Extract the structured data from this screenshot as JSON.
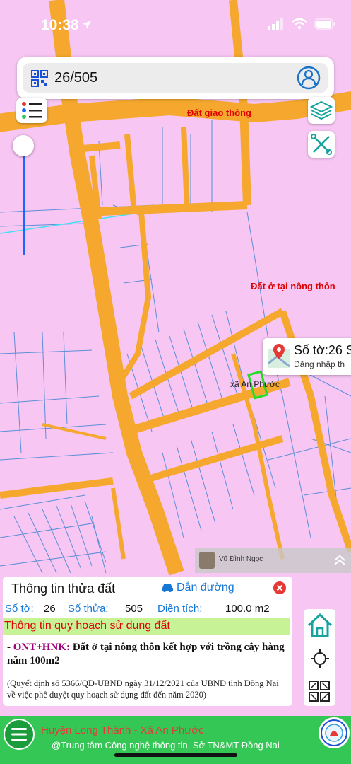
{
  "status": {
    "time": "10:38"
  },
  "search": {
    "value": "26/505"
  },
  "map": {
    "label_road": "Đất giao thông",
    "label_residential": "Đất ở tại nông thôn",
    "commune_label": "xã An Phước",
    "popup_title": "Số tờ:26 S",
    "popup_sub": "Đăng nhập th",
    "streetview_name": "Vũ Đình Ngọc",
    "colors": {
      "background": "#f7c6f3",
      "road": "#f5a82d",
      "parcel_line": "#5a8fd8",
      "selected_parcel": "#22dd22"
    }
  },
  "info": {
    "title": "Thông tin thửa đất",
    "route_label": "Dẫn đường",
    "sheet_label": "Số tờ:",
    "sheet_value": "26",
    "parcel_label": "Số thửa:",
    "parcel_value": "505",
    "area_label": "Diện tích:",
    "area_value": "100.0 m2",
    "section_title": "Thông tin quy hoạch sử dụng đất",
    "desc_prefix": "- ",
    "land_code": "ONT+HNK:",
    "land_desc": " Đất ở tại nông thôn kết hợp với trồng cây hàng năm 100m2",
    "note": "(Quyết định số 5366/QĐ-UBND ngày 31/12/2021 của UBND tỉnh Đồng Nai về việc phê duyệt quy hoạch sử dụng đất đến năm 2030)"
  },
  "bottom": {
    "location": "Huyện Long Thành - Xã An Phước",
    "credit": "@Trung tâm Công nghệ thông tin, Sở TN&MT Đồng Nai"
  },
  "icons": [
    "location-arrow-icon",
    "signal-icon",
    "wifi-icon",
    "battery-icon",
    "qr-scan-icon",
    "user-icon",
    "legend-icon",
    "layers-icon",
    "measure-icon",
    "map-pin-icon",
    "car-icon",
    "close-icon",
    "home-icon",
    "crosshair-icon",
    "expand-icon",
    "menu-icon",
    "logo-icon",
    "streetview-chevron-icon"
  ]
}
